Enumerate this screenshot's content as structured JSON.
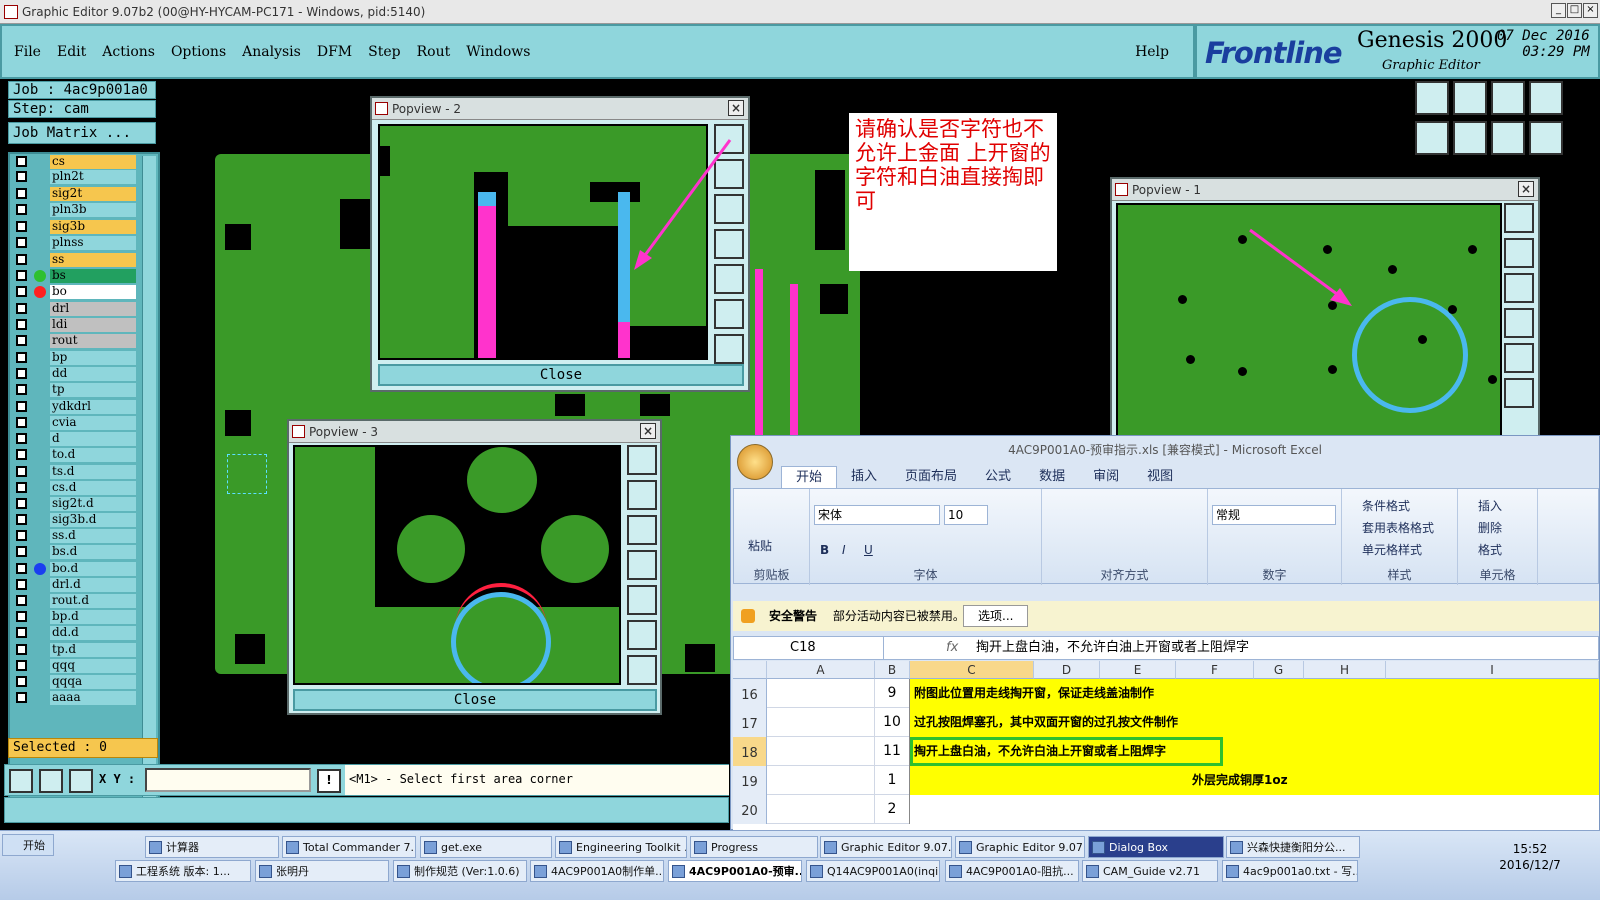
{
  "window": {
    "title": "Graphic Editor 9.07b2 (00@HY-HYCAM-PC171 - Windows, pid:5140)"
  },
  "menu": {
    "items": [
      "File",
      "Edit",
      "Actions",
      "Options",
      "Analysis",
      "DFM",
      "Step",
      "Rout",
      "Windows"
    ],
    "help": "Help"
  },
  "brand": {
    "logo": "Frontline",
    "product": "Genesis 2000",
    "subtitle": "Graphic Editor",
    "date": "07 Dec 2016",
    "time": "03:29 PM"
  },
  "job": {
    "job": "Job : 4ac9p001a0",
    "step": "Step: cam",
    "matrix": "Job Matrix ..."
  },
  "layers": [
    {
      "name": "cs",
      "color": "#f6c64e"
    },
    {
      "name": "pln2t",
      "color": "#8fd6dc"
    },
    {
      "name": "sig2t",
      "color": "#f6c64e"
    },
    {
      "name": "pln3b",
      "color": "#8fd6dc"
    },
    {
      "name": "sig3b",
      "color": "#f6c64e"
    },
    {
      "name": "plnss",
      "color": "#8fd6dc"
    },
    {
      "name": "ss",
      "color": "#f6c64e"
    },
    {
      "name": "bs",
      "color": "#22a060",
      "dot": "#2ec02e"
    },
    {
      "name": "bo",
      "color": "#ffffff",
      "dot": "#ff2020"
    },
    {
      "name": "drl",
      "color": "#c0c0c0"
    },
    {
      "name": "ldi",
      "color": "#c0c0c0"
    },
    {
      "name": "rout",
      "color": "#c0c0c0"
    },
    {
      "name": "bp",
      "color": "#8fd6dc"
    },
    {
      "name": "dd",
      "color": "#8fd6dc"
    },
    {
      "name": "tp",
      "color": "#8fd6dc"
    },
    {
      "name": "ydkdrl",
      "color": "#8fd6dc"
    },
    {
      "name": "cvia",
      "color": "#8fd6dc"
    },
    {
      "name": "d",
      "color": "#8fd6dc"
    },
    {
      "name": "to.d",
      "color": "#8fd6dc"
    },
    {
      "name": "ts.d",
      "color": "#8fd6dc"
    },
    {
      "name": "cs.d",
      "color": "#8fd6dc"
    },
    {
      "name": "sig2t.d",
      "color": "#8fd6dc"
    },
    {
      "name": "sig3b.d",
      "color": "#8fd6dc"
    },
    {
      "name": "ss.d",
      "color": "#8fd6dc"
    },
    {
      "name": "bs.d",
      "color": "#8fd6dc"
    },
    {
      "name": "bo.d",
      "color": "#8fd6dc",
      "dot": "#1a3ef0"
    },
    {
      "name": "drl.d",
      "color": "#8fd6dc"
    },
    {
      "name": "rout.d",
      "color": "#8fd6dc"
    },
    {
      "name": "bp.d",
      "color": "#8fd6dc"
    },
    {
      "name": "dd.d",
      "color": "#8fd6dc"
    },
    {
      "name": "tp.d",
      "color": "#8fd6dc"
    },
    {
      "name": "qqq",
      "color": "#8fd6dc"
    },
    {
      "name": "qqqa",
      "color": "#8fd6dc"
    },
    {
      "name": "aaaa",
      "color": "#8fd6dc"
    }
  ],
  "selected": "Selected : 0",
  "command": {
    "xy_label": "X Y :",
    "input_value": "",
    "message": "<M1> - Select first area corner"
  },
  "popups": {
    "p1": {
      "title": "Popview - 1"
    },
    "p2": {
      "title": "Popview - 2",
      "close": "Close"
    },
    "p3": {
      "title": "Popview - 3",
      "close": "Close"
    }
  },
  "note": "请确认是否字符也不允许上金面 上开窗的字符和白油直接掏即可",
  "excel": {
    "title": "4AC9P001A0-预审指示.xls [兼容模式] - Microsoft Excel",
    "tabs": [
      "开始",
      "插入",
      "页面布局",
      "公式",
      "数据",
      "审阅",
      "视图"
    ],
    "groups": {
      "clipboard": "剪贴板",
      "font": "字体",
      "align": "对齐方式",
      "number": "数字",
      "style": "样式",
      "cells": "单元格"
    },
    "paste": "粘贴",
    "font_name": "宋体",
    "font_size": "10",
    "number_format": "常规",
    "style_items": [
      "条件格式",
      "套用表格格式",
      "单元格样式"
    ],
    "cell_items": [
      "插入",
      "删除",
      "格式"
    ],
    "security": {
      "label": "安全警告",
      "text": "部分活动内容已被禁用。",
      "options": "选项..."
    },
    "namebox": "C18",
    "fx": "fx",
    "formula": "掏开上盘白油，不允许白油上开窗或者上阻焊字",
    "columns": [
      "A",
      "B",
      "C",
      "D",
      "E",
      "F",
      "G",
      "H",
      "I"
    ],
    "rows": [
      {
        "row": "16",
        "b": "9",
        "c": "附图此位置用走线掏开窗，保证走线盖油制作"
      },
      {
        "row": "17",
        "b": "10",
        "c": "过孔按阻焊塞孔，其中双面开窗的过孔按文件制作"
      },
      {
        "row": "18",
        "b": "11",
        "c": "掏开上盘白油，不允许白油上开窗或者上阻焊字"
      },
      {
        "row": "19",
        "b": "1",
        "c": "外层完成铜厚1oz"
      },
      {
        "row": "20",
        "b": "2",
        "c": ""
      }
    ]
  },
  "taskbar": {
    "start": "开始",
    "row1": [
      "计算器",
      "Total Commander 7....",
      "get.exe",
      "Engineering Toolkit ...",
      "Progress",
      "Graphic Editor 9.07...",
      "Graphic Editor 9.07...",
      "Dialog Box",
      "兴森快捷衡阳分公..."
    ],
    "row2": [
      "工程系统  版本: 1...",
      "张明丹",
      "制作规范 (Ver:1.0.6)",
      "4AC9P001A0制作单...",
      "4AC9P001A0-预审...",
      "Q14AC9P001A0(inqi...",
      "4AC9P001A0-阻抗...",
      "CAM_Guide v2.71",
      "4ac9p001a0.txt - 写..."
    ],
    "time": "15:52",
    "date": "2016/12/7"
  }
}
